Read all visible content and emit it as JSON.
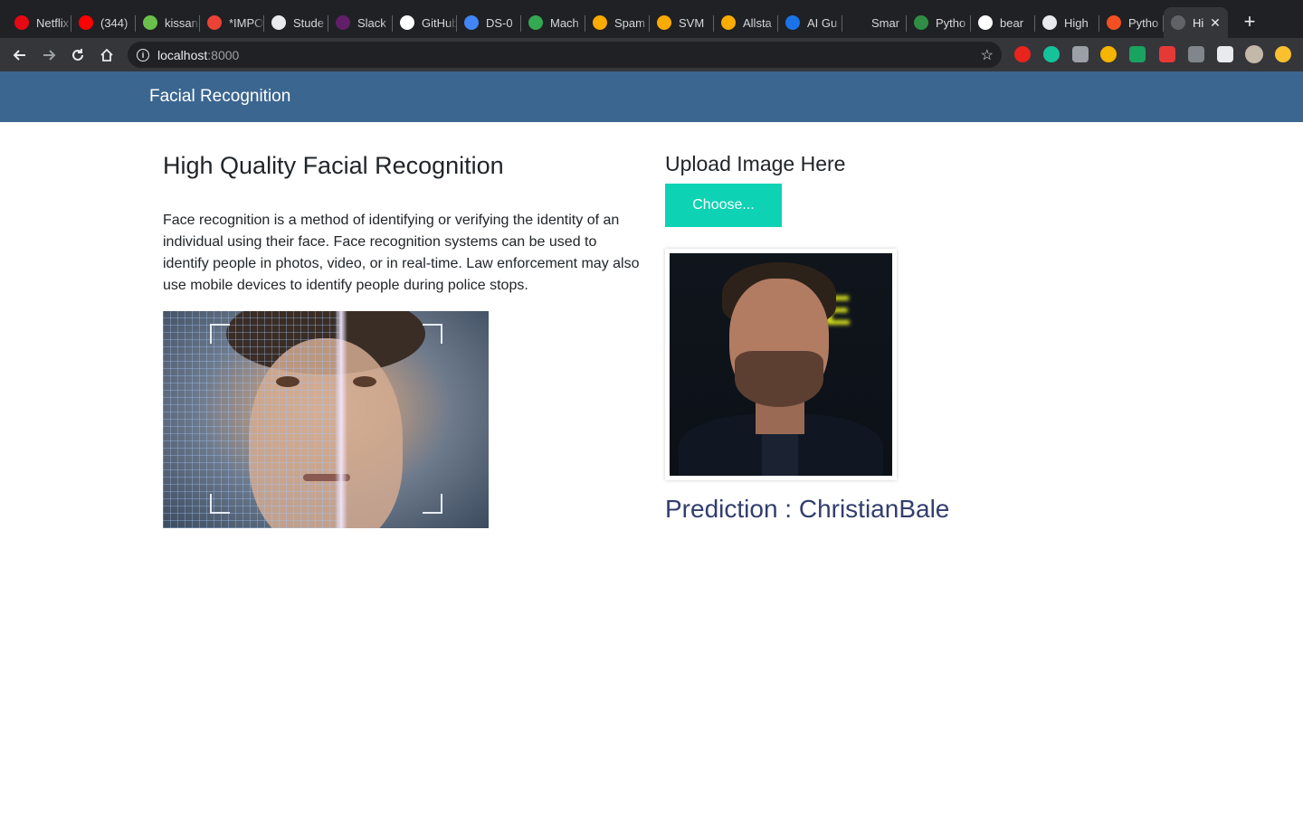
{
  "browser": {
    "tabs": [
      {
        "title": "Netflix",
        "favicon": "netflix-icon",
        "color": "#e50914"
      },
      {
        "title": "(344)",
        "favicon": "youtube-icon",
        "color": "#ff0000"
      },
      {
        "title": "kissanime",
        "favicon": "kiss-icon",
        "color": "#6ac04b"
      },
      {
        "title": "*IMPO",
        "favicon": "gmail-icon",
        "color": "#ea4335"
      },
      {
        "title": "Stude",
        "favicon": "globe-icon",
        "color": "#e8eaed"
      },
      {
        "title": "Slack",
        "favicon": "slack-icon",
        "color": "#611f69"
      },
      {
        "title": "GitHub",
        "favicon": "github-icon",
        "color": "#ffffff"
      },
      {
        "title": "DS-0",
        "favicon": "classroom-icon",
        "color": "#4285f4"
      },
      {
        "title": "Mach",
        "favicon": "drive-icon",
        "color": "#34a853"
      },
      {
        "title": "Spam",
        "favicon": "colab-icon",
        "color": "#f9ab00"
      },
      {
        "title": "SVM",
        "favicon": "colab-icon",
        "color": "#f9ab00"
      },
      {
        "title": "Allsta",
        "favicon": "colab-icon",
        "color": "#f9ab00"
      },
      {
        "title": "AI Gu",
        "favicon": "ai-icon",
        "color": "#1a73e8"
      },
      {
        "title": "Smar",
        "favicon": "dash-icon",
        "color": "#202124"
      },
      {
        "title": "Pytho",
        "favicon": "geeks-icon",
        "color": "#2f8d46"
      },
      {
        "title": "bear",
        "favicon": "google-icon",
        "color": "#ffffff"
      },
      {
        "title": "High",
        "favicon": "globe-icon",
        "color": "#e8eaed"
      },
      {
        "title": "Pytho",
        "favicon": "microsoft-icon",
        "color": "#f25022"
      },
      {
        "title": "Hi",
        "favicon": "globe-icon",
        "color": "#5f6368",
        "active": true
      }
    ],
    "url_host": "localhost",
    "url_port": ":8000"
  },
  "navbar": {
    "brand": "Facial Recognition"
  },
  "left": {
    "heading": "High Quality Facial Recognition",
    "description": "Face recognition is a method of identifying or verifying the identity of an individual using their face. Face recognition systems can be used to identify people in photos, video, or in real-time. Law enforcement may also use mobile devices to identify people during police stops."
  },
  "right": {
    "upload_heading": "Upload Image Here",
    "choose_label": "Choose...",
    "prediction": "Prediction : ChristianBale"
  },
  "colors": {
    "navbar": "#3b6690",
    "button": "#0dd3b4",
    "prediction": "#323e6e"
  }
}
